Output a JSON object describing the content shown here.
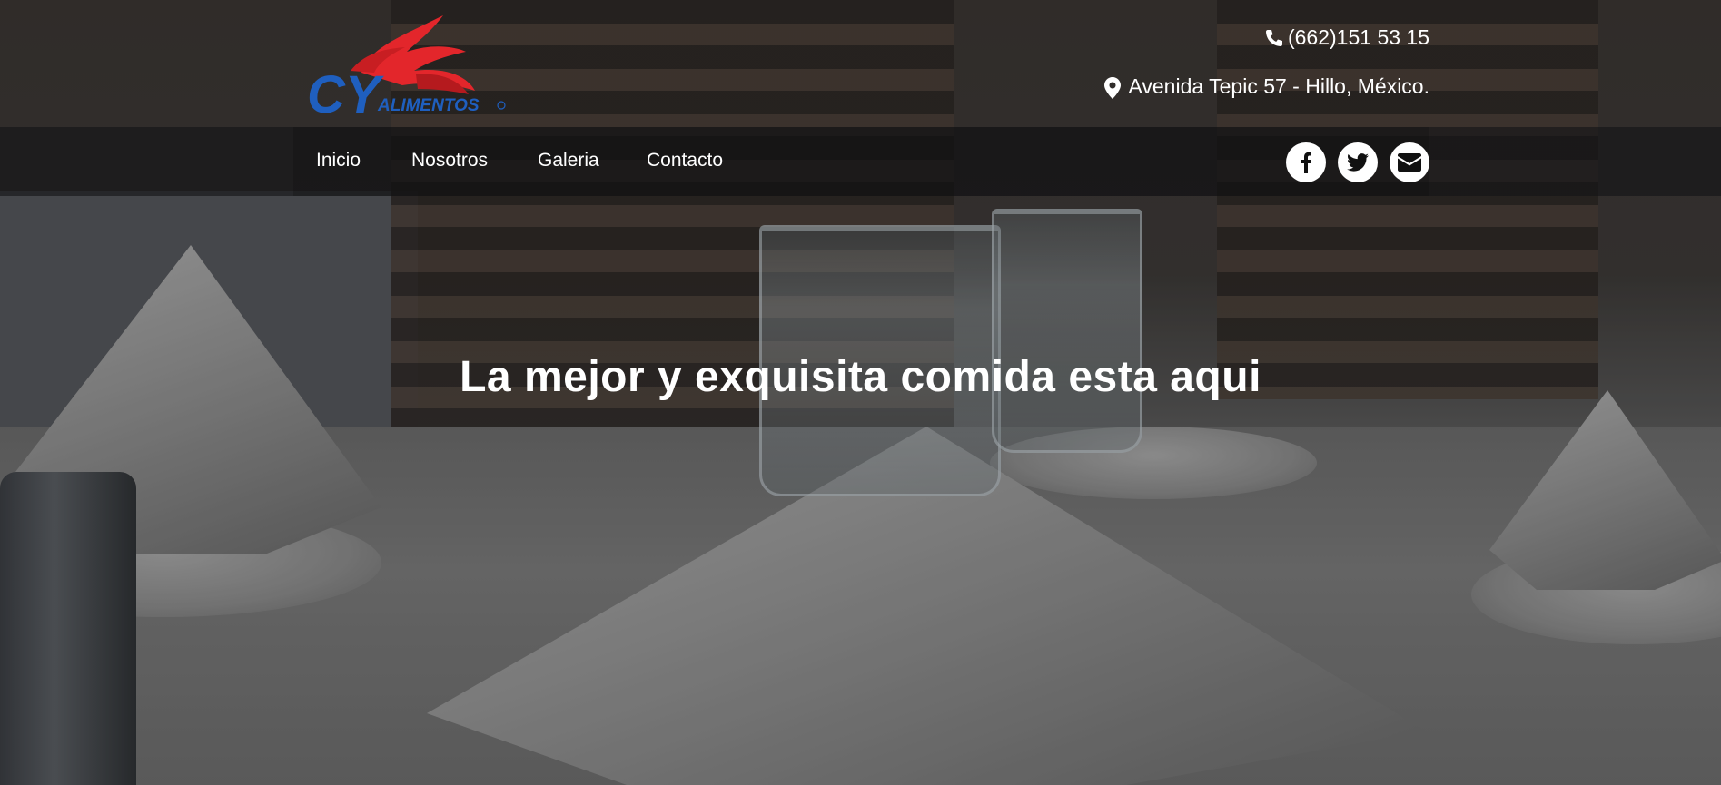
{
  "brand": {
    "logo_text_main": "CY",
    "logo_text_sub": "ALIMENTOS",
    "primary_color": "#1f5fbf",
    "accent_color": "#e3262b"
  },
  "contact": {
    "phone": "(662)151 53 15",
    "address": "Avenida Tepic 57 - Hillo, México."
  },
  "nav": {
    "items": [
      {
        "label": "Inicio"
      },
      {
        "label": "Nosotros"
      },
      {
        "label": "Galeria"
      },
      {
        "label": "Contacto"
      }
    ]
  },
  "social": {
    "icons": [
      "facebook-icon",
      "twitter-icon",
      "envelope-icon"
    ]
  },
  "hero": {
    "title": "La mejor y exquisita comida esta aqui"
  }
}
